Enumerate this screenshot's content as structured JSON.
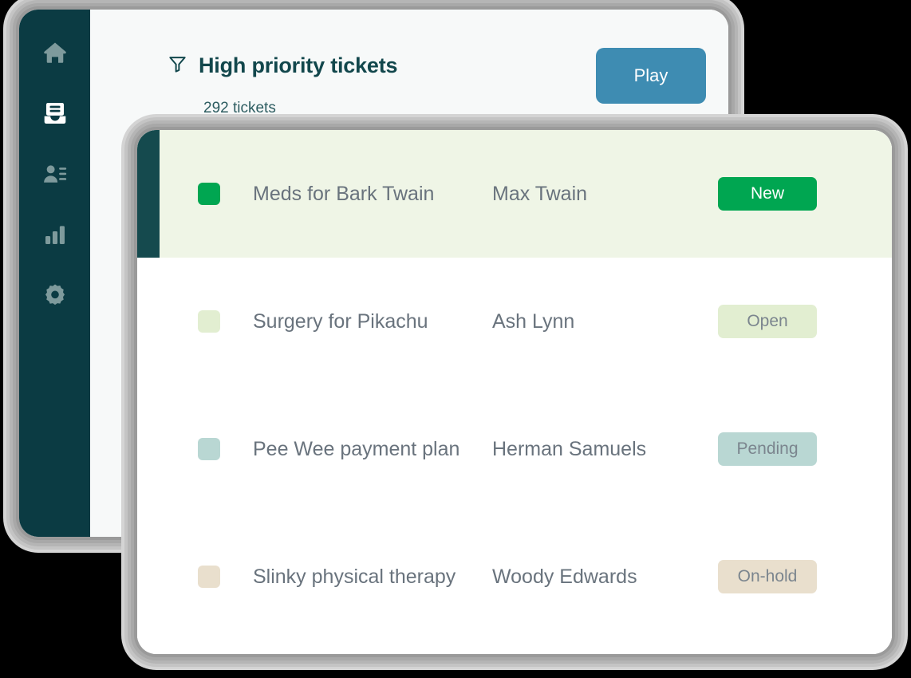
{
  "back_window": {
    "sidebar": {
      "background": "#0b3b43",
      "items": [
        {
          "icon": "home-icon",
          "name": "home",
          "active": false
        },
        {
          "icon": "inbox-icon",
          "name": "tickets",
          "active": true
        },
        {
          "icon": "contact-list-icon",
          "name": "contacts",
          "active": false
        },
        {
          "icon": "bar-chart-icon",
          "name": "reports",
          "active": false
        },
        {
          "icon": "gear-icon",
          "name": "settings",
          "active": false
        }
      ]
    },
    "header": {
      "filter_icon": "filter-icon",
      "title": "High priority tickets",
      "subtitle": "292 tickets",
      "title_color": "#12474c",
      "play_button": {
        "label": "Play",
        "background": "#3e8cb2",
        "text_color": "#ffffff"
      }
    }
  },
  "front_card": {
    "rows": [
      {
        "title": "Meds for Bark Twain",
        "person": "Max Twain",
        "status": "New",
        "swatch_color": "#00a651",
        "badge_bg": "#00a651",
        "badge_text_color": "#ffffff",
        "selected": true,
        "row_bg": "#eff5e6",
        "accent_color": "#154a4e"
      },
      {
        "title": "Surgery for Pikachu",
        "person": "Ash Lynn",
        "status": "Open",
        "swatch_color": "#e2eed1",
        "badge_bg": "#e2eed1",
        "badge_text_color": "#7b858e",
        "selected": false,
        "row_bg": "#ffffff",
        "accent_color": "transparent"
      },
      {
        "title": "Pee Wee payment plan",
        "person": "Herman Samuels",
        "status": "Pending",
        "swatch_color": "#b9d7d3",
        "badge_bg": "#b9d7d3",
        "badge_text_color": "#7b858e",
        "selected": false,
        "row_bg": "#ffffff",
        "accent_color": "transparent"
      },
      {
        "title": "Slinky physical therapy",
        "person": "Woody Edwards",
        "status": "On-hold",
        "swatch_color": "#e9dfcd",
        "badge_bg": "#e9dfcd",
        "badge_text_color": "#7b858e",
        "selected": false,
        "row_bg": "#ffffff",
        "accent_color": "transparent"
      }
    ]
  }
}
